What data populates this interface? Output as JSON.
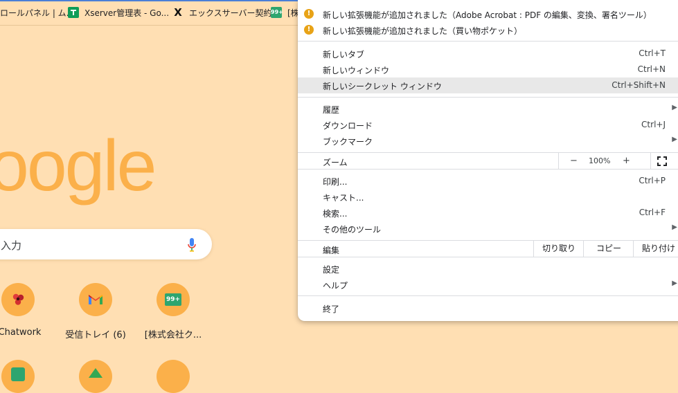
{
  "bookmarks": [
    {
      "label": "ロールパネル | ム...",
      "icon": "none"
    },
    {
      "label": "Xserver管理表 - Go...",
      "icon": "google-sheets-icon"
    },
    {
      "label": "エックスサーバー契約...",
      "icon": "x-logo-icon"
    },
    {
      "label": "[株",
      "icon": "badge-99-icon",
      "badge": "99+"
    }
  ],
  "ntp": {
    "logo_text": "oogle",
    "search_placeholder": "入力",
    "shortcuts": [
      {
        "label": "]Chatwork",
        "icon": "chatwork-icon"
      },
      {
        "label": "受信トレイ (6)",
        "icon": "gmail-icon"
      },
      {
        "label": "[株式会社ク...",
        "icon": "badge-99-icon",
        "badge": "99+"
      }
    ]
  },
  "menu": {
    "notices": [
      {
        "label": "新しい拡張機能が追加されました（Adobe Acrobat : PDF の編集、変換、署名ツール）",
        "icon": "!"
      },
      {
        "label": "新しい拡張機能が追加されました（買い物ポケット）",
        "icon": "!"
      }
    ],
    "group1": [
      {
        "label": "新しいタブ",
        "shortcut": "Ctrl+T"
      },
      {
        "label": "新しいウィンドウ",
        "shortcut": "Ctrl+N"
      },
      {
        "label": "新しいシークレット ウィンドウ",
        "shortcut": "Ctrl+Shift+N",
        "highlighted": true
      }
    ],
    "group2": [
      {
        "label": "履歴",
        "arrow": "▶"
      },
      {
        "label": "ダウンロード",
        "shortcut": "Ctrl+J"
      },
      {
        "label": "ブックマーク",
        "arrow": "▶"
      }
    ],
    "zoom": {
      "label": "ズーム",
      "minus": "−",
      "value": "100%",
      "plus": "+"
    },
    "group3": [
      {
        "label": "印刷...",
        "shortcut": "Ctrl+P"
      },
      {
        "label": "キャスト..."
      },
      {
        "label": "検索...",
        "shortcut": "Ctrl+F"
      },
      {
        "label": "その他のツール",
        "arrow": "▶"
      }
    ],
    "edit": {
      "label": "編集",
      "cut": "切り取り",
      "copy": "コピー",
      "paste": "貼り付け"
    },
    "group4": [
      {
        "label": "設定"
      },
      {
        "label": "ヘルプ",
        "arrow": "▶"
      }
    ],
    "exit": {
      "label": "終了"
    }
  },
  "colors": {
    "background": "#ffdfb3",
    "logo": "#fbb04a",
    "highlight_row": "#e8e8e8",
    "notice_icon": "#e8a317"
  }
}
